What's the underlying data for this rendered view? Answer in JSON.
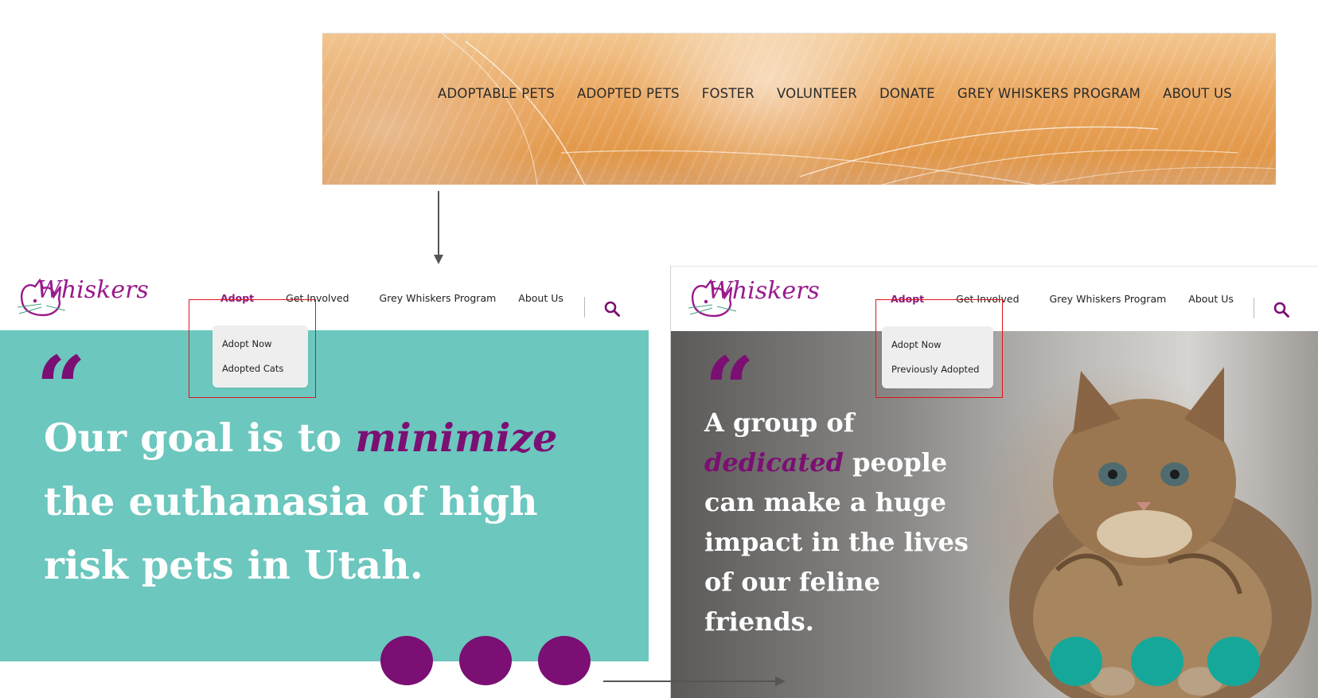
{
  "old_header": {
    "nav": [
      "ADOPTABLE PETS",
      "ADOPTED PETS",
      "FOSTER",
      "VOLUNTEER",
      "DONATE",
      "GREY WHISKERS PROGRAM",
      "ABOUT US"
    ]
  },
  "mockup_left": {
    "logo_text": "Whiskers",
    "nav": {
      "adopt": "Adopt",
      "get_involved": "Get Involved",
      "grey_whiskers": "Grey Whiskers Program",
      "about": "About Us"
    },
    "dropdown": [
      "Adopt Now",
      "Adopted Cats"
    ],
    "quote_mark": "“",
    "headline": {
      "part1": "Our goal is to ",
      "highlight": "minimize",
      "part2": " the euthanasia of high risk pets in Utah."
    }
  },
  "mockup_right": {
    "logo_text": "Whiskers",
    "nav": {
      "adopt": "Adopt",
      "get_involved": "Get Involved",
      "grey_whiskers": "Grey Whiskers Program",
      "about": "About Us"
    },
    "dropdown": [
      "Adopt Now",
      "Previously Adopted"
    ],
    "quote_mark": "“",
    "headline": {
      "part1": "A group of ",
      "highlight": "dedicated",
      "part2": " people can make a huge impact in the lives of our feline friends."
    }
  },
  "colors": {
    "brand_purple": "#7b0f73",
    "teal_panel": "#6cc7be",
    "teal_dot": "#15a89a",
    "highlight_red": "#e0141b"
  },
  "icons": [
    "search-icon",
    "cat-logo-icon"
  ]
}
